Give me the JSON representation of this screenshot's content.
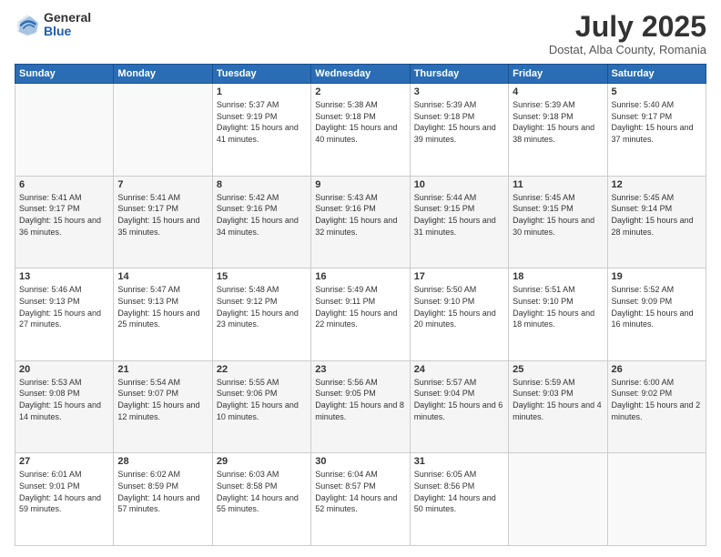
{
  "logo": {
    "general": "General",
    "blue": "Blue"
  },
  "title": "July 2025",
  "location": "Dostat, Alba County, Romania",
  "weekdays": [
    "Sunday",
    "Monday",
    "Tuesday",
    "Wednesday",
    "Thursday",
    "Friday",
    "Saturday"
  ],
  "weeks": [
    [
      {
        "day": "",
        "sunrise": "",
        "sunset": "",
        "daylight": "",
        "empty": true
      },
      {
        "day": "",
        "sunrise": "",
        "sunset": "",
        "daylight": "",
        "empty": true
      },
      {
        "day": "1",
        "sunrise": "Sunrise: 5:37 AM",
        "sunset": "Sunset: 9:19 PM",
        "daylight": "Daylight: 15 hours and 41 minutes."
      },
      {
        "day": "2",
        "sunrise": "Sunrise: 5:38 AM",
        "sunset": "Sunset: 9:18 PM",
        "daylight": "Daylight: 15 hours and 40 minutes."
      },
      {
        "day": "3",
        "sunrise": "Sunrise: 5:39 AM",
        "sunset": "Sunset: 9:18 PM",
        "daylight": "Daylight: 15 hours and 39 minutes."
      },
      {
        "day": "4",
        "sunrise": "Sunrise: 5:39 AM",
        "sunset": "Sunset: 9:18 PM",
        "daylight": "Daylight: 15 hours and 38 minutes."
      },
      {
        "day": "5",
        "sunrise": "Sunrise: 5:40 AM",
        "sunset": "Sunset: 9:17 PM",
        "daylight": "Daylight: 15 hours and 37 minutes."
      }
    ],
    [
      {
        "day": "6",
        "sunrise": "Sunrise: 5:41 AM",
        "sunset": "Sunset: 9:17 PM",
        "daylight": "Daylight: 15 hours and 36 minutes."
      },
      {
        "day": "7",
        "sunrise": "Sunrise: 5:41 AM",
        "sunset": "Sunset: 9:17 PM",
        "daylight": "Daylight: 15 hours and 35 minutes."
      },
      {
        "day": "8",
        "sunrise": "Sunrise: 5:42 AM",
        "sunset": "Sunset: 9:16 PM",
        "daylight": "Daylight: 15 hours and 34 minutes."
      },
      {
        "day": "9",
        "sunrise": "Sunrise: 5:43 AM",
        "sunset": "Sunset: 9:16 PM",
        "daylight": "Daylight: 15 hours and 32 minutes."
      },
      {
        "day": "10",
        "sunrise": "Sunrise: 5:44 AM",
        "sunset": "Sunset: 9:15 PM",
        "daylight": "Daylight: 15 hours and 31 minutes."
      },
      {
        "day": "11",
        "sunrise": "Sunrise: 5:45 AM",
        "sunset": "Sunset: 9:15 PM",
        "daylight": "Daylight: 15 hours and 30 minutes."
      },
      {
        "day": "12",
        "sunrise": "Sunrise: 5:45 AM",
        "sunset": "Sunset: 9:14 PM",
        "daylight": "Daylight: 15 hours and 28 minutes."
      }
    ],
    [
      {
        "day": "13",
        "sunrise": "Sunrise: 5:46 AM",
        "sunset": "Sunset: 9:13 PM",
        "daylight": "Daylight: 15 hours and 27 minutes."
      },
      {
        "day": "14",
        "sunrise": "Sunrise: 5:47 AM",
        "sunset": "Sunset: 9:13 PM",
        "daylight": "Daylight: 15 hours and 25 minutes."
      },
      {
        "day": "15",
        "sunrise": "Sunrise: 5:48 AM",
        "sunset": "Sunset: 9:12 PM",
        "daylight": "Daylight: 15 hours and 23 minutes."
      },
      {
        "day": "16",
        "sunrise": "Sunrise: 5:49 AM",
        "sunset": "Sunset: 9:11 PM",
        "daylight": "Daylight: 15 hours and 22 minutes."
      },
      {
        "day": "17",
        "sunrise": "Sunrise: 5:50 AM",
        "sunset": "Sunset: 9:10 PM",
        "daylight": "Daylight: 15 hours and 20 minutes."
      },
      {
        "day": "18",
        "sunrise": "Sunrise: 5:51 AM",
        "sunset": "Sunset: 9:10 PM",
        "daylight": "Daylight: 15 hours and 18 minutes."
      },
      {
        "day": "19",
        "sunrise": "Sunrise: 5:52 AM",
        "sunset": "Sunset: 9:09 PM",
        "daylight": "Daylight: 15 hours and 16 minutes."
      }
    ],
    [
      {
        "day": "20",
        "sunrise": "Sunrise: 5:53 AM",
        "sunset": "Sunset: 9:08 PM",
        "daylight": "Daylight: 15 hours and 14 minutes."
      },
      {
        "day": "21",
        "sunrise": "Sunrise: 5:54 AM",
        "sunset": "Sunset: 9:07 PM",
        "daylight": "Daylight: 15 hours and 12 minutes."
      },
      {
        "day": "22",
        "sunrise": "Sunrise: 5:55 AM",
        "sunset": "Sunset: 9:06 PM",
        "daylight": "Daylight: 15 hours and 10 minutes."
      },
      {
        "day": "23",
        "sunrise": "Sunrise: 5:56 AM",
        "sunset": "Sunset: 9:05 PM",
        "daylight": "Daylight: 15 hours and 8 minutes."
      },
      {
        "day": "24",
        "sunrise": "Sunrise: 5:57 AM",
        "sunset": "Sunset: 9:04 PM",
        "daylight": "Daylight: 15 hours and 6 minutes."
      },
      {
        "day": "25",
        "sunrise": "Sunrise: 5:59 AM",
        "sunset": "Sunset: 9:03 PM",
        "daylight": "Daylight: 15 hours and 4 minutes."
      },
      {
        "day": "26",
        "sunrise": "Sunrise: 6:00 AM",
        "sunset": "Sunset: 9:02 PM",
        "daylight": "Daylight: 15 hours and 2 minutes."
      }
    ],
    [
      {
        "day": "27",
        "sunrise": "Sunrise: 6:01 AM",
        "sunset": "Sunset: 9:01 PM",
        "daylight": "Daylight: 14 hours and 59 minutes."
      },
      {
        "day": "28",
        "sunrise": "Sunrise: 6:02 AM",
        "sunset": "Sunset: 8:59 PM",
        "daylight": "Daylight: 14 hours and 57 minutes."
      },
      {
        "day": "29",
        "sunrise": "Sunrise: 6:03 AM",
        "sunset": "Sunset: 8:58 PM",
        "daylight": "Daylight: 14 hours and 55 minutes."
      },
      {
        "day": "30",
        "sunrise": "Sunrise: 6:04 AM",
        "sunset": "Sunset: 8:57 PM",
        "daylight": "Daylight: 14 hours and 52 minutes."
      },
      {
        "day": "31",
        "sunrise": "Sunrise: 6:05 AM",
        "sunset": "Sunset: 8:56 PM",
        "daylight": "Daylight: 14 hours and 50 minutes."
      },
      {
        "day": "",
        "sunrise": "",
        "sunset": "",
        "daylight": "",
        "empty": true
      },
      {
        "day": "",
        "sunrise": "",
        "sunset": "",
        "daylight": "",
        "empty": true
      }
    ]
  ]
}
